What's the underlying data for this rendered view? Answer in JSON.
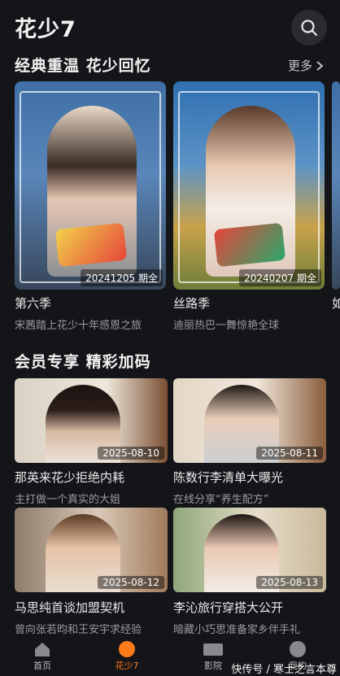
{
  "header": {
    "title": "花少7"
  },
  "section1": {
    "title": "经典重温 花少回忆",
    "more": "更多",
    "posters": [
      {
        "badge": "20241205 期全",
        "name": "第六季",
        "desc": "宋茜踏上花少十年感恩之旅"
      },
      {
        "badge": "20240207 期全",
        "name": "丝路季",
        "desc": "迪丽热巴一舞惊艳全球"
      },
      {
        "name": "如"
      }
    ]
  },
  "section2": {
    "title": "会员专享 精彩加码",
    "cards": [
      {
        "date": "2025-08-10",
        "title": "那英来花少拒绝内耗",
        "sub": "主打做一个真实的大姐"
      },
      {
        "date": "2025-08-11",
        "title": "陈数行李清单大曝光",
        "sub": "在线分享“养生配方”"
      },
      {
        "date": "2025-08-12",
        "title": "马思纯首谈加盟契机",
        "sub": "曾向张若昀和王安宇求经验"
      },
      {
        "date": "2025-08-13",
        "title": "李沁旅行穿搭大公开",
        "sub": "暗藏小巧思准备家乡伴手礼"
      }
    ]
  },
  "tabbar": {
    "items": [
      {
        "label": "首页",
        "icon": "home-icon"
      },
      {
        "label": "花少7",
        "icon": "flower-icon",
        "active": true
      },
      {
        "label": "影院",
        "icon": "cinema-icon"
      },
      {
        "label": "我的",
        "icon": "profile-icon"
      }
    ],
    "active_color": "#ff7a1a"
  },
  "watermark": "快传号 / 寒士之言本尊"
}
